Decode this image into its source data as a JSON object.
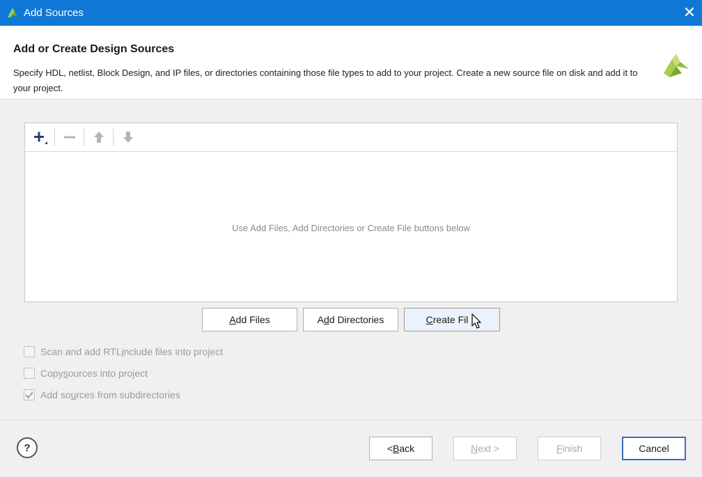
{
  "window": {
    "title": "Add Sources",
    "close_glyph": "✕",
    "icon": "vivado-logo-icon"
  },
  "header": {
    "title": "Add or Create Design Sources",
    "description": "Specify HDL, netlist, Block Design, and IP files, or directories containing those file types to add to your project. Create a new source file on disk and add it to your project."
  },
  "toolbar": {
    "items": [
      "plus-icon",
      "minus-icon",
      "arrow-up-icon",
      "arrow-down-icon"
    ]
  },
  "file_list": {
    "empty_message": "Use Add Files, Add Directories or Create File buttons below"
  },
  "buttons": {
    "add_files": {
      "pre": "",
      "u": "A",
      "post": "dd Files"
    },
    "add_directories": {
      "pre": "A",
      "u": "d",
      "post": "d Directories"
    },
    "create_file": {
      "pre": "",
      "u": "C",
      "post": "reate Fil"
    }
  },
  "options": {
    "scan_rtl": {
      "pre": "Scan and add RTL ",
      "u": "i",
      "post": "nclude files into project",
      "checked": false
    },
    "copy_sources": {
      "pre": "Copy ",
      "u": "s",
      "post": "ources into project",
      "checked": false
    },
    "subdirectories": {
      "pre": "Add so",
      "u": "u",
      "post": "rces from subdirectories",
      "checked": true
    }
  },
  "footer": {
    "help": "?",
    "back": {
      "pre": "< ",
      "u": "B",
      "post": "ack"
    },
    "next": {
      "pre": "",
      "u": "N",
      "post": "ext >"
    },
    "finish": {
      "pre": "",
      "u": "F",
      "post": "inish"
    },
    "cancel": "Cancel"
  },
  "colors": {
    "titlebar": "#0f78d6",
    "accent_green": "#8fbf3a"
  }
}
